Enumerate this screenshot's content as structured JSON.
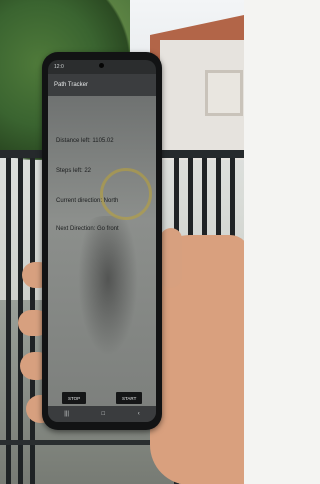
{
  "app": {
    "title": "Path Tracker",
    "status_time": "12:0"
  },
  "info": {
    "distance_left": "Distance left: 1105.02",
    "steps_left": "Steps left: 22",
    "current_direction": "Current direction: North",
    "next_direction": "Next Direction: Go front"
  },
  "buttons": {
    "stop": "STOP",
    "start": "START"
  },
  "navbar": {
    "recents_icon": "|||",
    "home_icon": "□",
    "back_icon": "‹"
  },
  "colors": {
    "phone_body": "#121314",
    "appbar": "#3b3d3f",
    "screen_bg": "#8c8f8c",
    "button_bg": "#151617",
    "hand": "#d9a07e"
  }
}
